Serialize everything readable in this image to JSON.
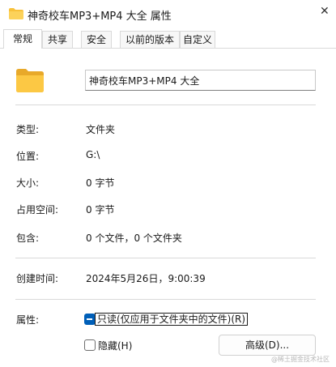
{
  "window": {
    "title": "神奇校车MP3+MP4 大全 属性",
    "close_glyph": "✕",
    "accent_color": "#005fb8",
    "folder_color": "#f8c13a"
  },
  "tabs": [
    {
      "label": "常规",
      "active": true
    },
    {
      "label": "共享",
      "active": false
    },
    {
      "label": "安全",
      "active": false
    },
    {
      "label": "以前的版本",
      "active": false
    },
    {
      "label": "自定义",
      "active": false
    }
  ],
  "general": {
    "folder_icon": "folder-icon",
    "name_value": "神奇校车MP3+MP4 大全",
    "type_label": "类型:",
    "type_value": "文件夹",
    "location_label": "位置:",
    "location_value": "G:\\",
    "size_label": "大小:",
    "size_value": "0 字节",
    "size_on_disk_label": "占用空间:",
    "size_on_disk_value": "0 字节",
    "contains_label": "包含:",
    "contains_value": "0 个文件，0 个文件夹",
    "created_label": "创建时间:",
    "created_value": "2024年5月26日，9:00:39",
    "attributes_label": "属性:",
    "readonly_label": "只读(仅应用于文件夹中的文件)(R)",
    "readonly_state": "indeterminate",
    "hidden_label": "隐藏(H)",
    "hidden_checked": false,
    "advanced_button": "高级(D)..."
  },
  "watermark": "@稀土掘金技术社区"
}
